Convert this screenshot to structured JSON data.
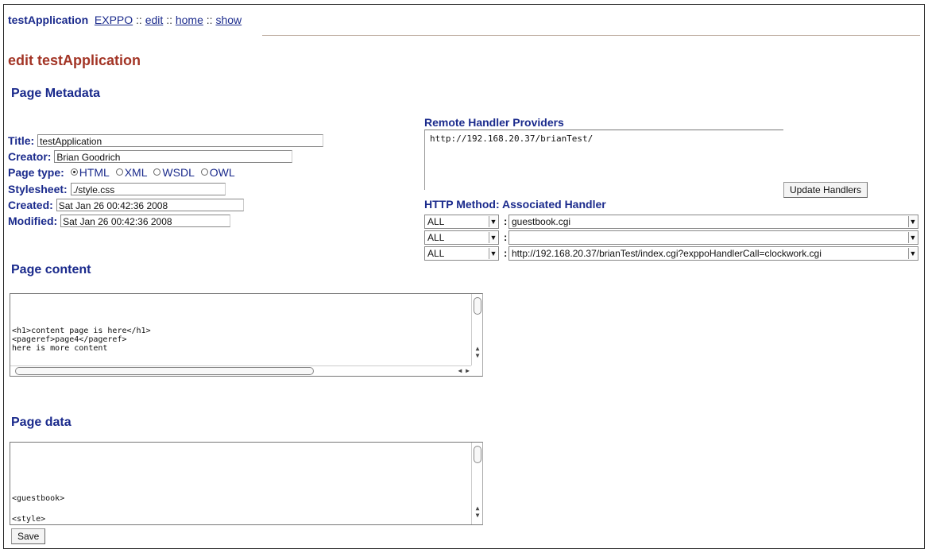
{
  "nav": {
    "app_name": "testApplication",
    "links": [
      "EXPPO",
      "edit",
      "home",
      "show"
    ],
    "separator": "::"
  },
  "page_title": "edit testApplication",
  "metadata": {
    "heading": "Page Metadata",
    "title_label": "Title:",
    "title_value": "testApplication",
    "creator_label": "Creator:",
    "creator_value": "Brian Goodrich",
    "page_type_label": "Page type:",
    "page_type_options": [
      "HTML",
      "XML",
      "WSDL",
      "OWL"
    ],
    "page_type_selected": "HTML",
    "stylesheet_label": "Stylesheet:",
    "stylesheet_value": "./style.css",
    "created_label": "Created:",
    "created_value": "Sat Jan 26 00:42:36 2008",
    "modified_label": "Modified:",
    "modified_value": "Sat Jan 26 00:42:36 2008"
  },
  "remote": {
    "heading": "Remote Handler Providers",
    "providers_text": "http://192.168.20.37/brianTest/",
    "update_button": "Update Handlers"
  },
  "handlers": {
    "heading": "HTTP Method: Associated Handler",
    "rows": [
      {
        "method": "ALL",
        "handler": "guestbook.cgi"
      },
      {
        "method": "ALL",
        "handler": ""
      },
      {
        "method": "ALL",
        "handler": "http://192.168.20.37/brianTest/index.cgi?exppoHandlerCall=clockwork.cgi"
      }
    ]
  },
  "content": {
    "heading": "Page content",
    "lines": [
      "<h1>content page is here</h1>",
      "<pageref>page4</pageref>",
      "here is more content"
    ]
  },
  "page_data": {
    "heading": "Page data",
    "lines": [
      "<guestbook>",
      "<style>"
    ]
  },
  "save_button": "Save",
  "colors": {
    "heading": "#1a2a8c",
    "title": "#a33526",
    "rule": "#b9a79a"
  },
  "icons": {
    "dropdown": "triangle-down",
    "scroll_up": "triangle-up",
    "scroll_down": "triangle-down"
  }
}
